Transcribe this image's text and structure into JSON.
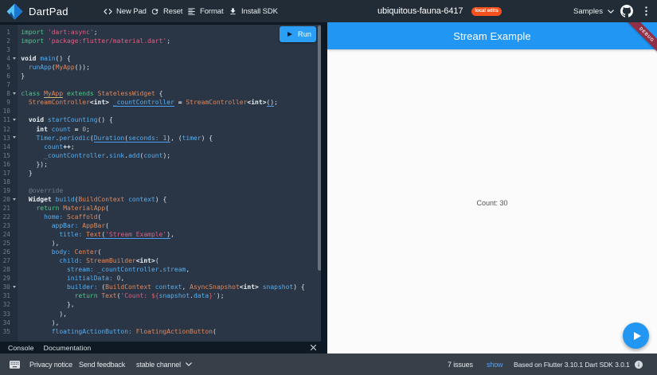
{
  "header": {
    "app_name": "DartPad",
    "buttons": {
      "new_pad": "New Pad",
      "reset": "Reset",
      "format": "Format",
      "install_sdk": "Install SDK"
    },
    "pad_title": "ubiquitous-fauna-6417",
    "badge": "local edits",
    "samples_label": "Samples",
    "icons": [
      "dart-logo",
      "code-icon",
      "refresh-icon",
      "format-align-icon",
      "download-icon",
      "chevron-down-icon",
      "github-icon",
      "kebab-menu-icon"
    ]
  },
  "editor": {
    "run_label": "Run",
    "fold_lines": [
      4,
      8,
      11,
      13,
      20,
      30
    ],
    "lines": [
      [
        [
          "kw",
          "import"
        ],
        [
          "pl",
          " "
        ],
        [
          "str",
          "'dart:async'"
        ],
        [
          "pl",
          ";"
        ]
      ],
      [
        [
          "kw",
          "import"
        ],
        [
          "pl",
          " "
        ],
        [
          "str",
          "'package:flutter/material.dart'"
        ],
        [
          "pl",
          ";"
        ]
      ],
      [],
      [
        [
          "ty",
          "void"
        ],
        [
          "pl",
          " "
        ],
        [
          "vr",
          "main"
        ],
        [
          "pl",
          "() {"
        ]
      ],
      [
        [
          "pl",
          "  "
        ],
        [
          "vr",
          "runApp"
        ],
        [
          "pl",
          "("
        ],
        [
          "cls",
          "MyApp"
        ],
        [
          "pl",
          "());"
        ]
      ],
      [
        [
          "pl",
          "}"
        ]
      ],
      [],
      [
        [
          "kw",
          "class"
        ],
        [
          "pl",
          " "
        ],
        [
          "cls uy",
          "MyApp"
        ],
        [
          "pl",
          " "
        ],
        [
          "kw",
          "extends"
        ],
        [
          "pl",
          " "
        ],
        [
          "cls",
          "StatelessWidget"
        ],
        [
          "pl",
          " {"
        ]
      ],
      [
        [
          "pl",
          "  "
        ],
        [
          "cls",
          "StreamController"
        ],
        [
          "op",
          "<int>"
        ],
        [
          "pl",
          " "
        ],
        [
          "vr ub",
          "_countController"
        ],
        [
          "pl",
          " "
        ],
        [
          "op",
          "="
        ],
        [
          "pl",
          " "
        ],
        [
          "cls",
          "StreamController"
        ],
        [
          "op",
          "<int>"
        ],
        [
          "pl ub",
          "()"
        ],
        [
          "pl",
          ";"
        ]
      ],
      [],
      [
        [
          "pl",
          "  "
        ],
        [
          "ty",
          "void"
        ],
        [
          "pl",
          " "
        ],
        [
          "vr",
          "startCounting"
        ],
        [
          "pl",
          "() {"
        ]
      ],
      [
        [
          "pl",
          "    "
        ],
        [
          "ty",
          "int"
        ],
        [
          "pl",
          " "
        ],
        [
          "vr",
          "count"
        ],
        [
          "pl",
          " "
        ],
        [
          "op",
          "="
        ],
        [
          "pl",
          " "
        ],
        [
          "nm",
          "0"
        ],
        [
          "pl",
          ";"
        ]
      ],
      [
        [
          "pl",
          "    "
        ],
        [
          "vr",
          "Timer"
        ],
        [
          "pl",
          "."
        ],
        [
          "vr",
          "periodic"
        ],
        [
          "pl",
          "("
        ],
        [
          "vr ub",
          "Duration"
        ],
        [
          "pl ub",
          "("
        ],
        [
          "vr ub",
          "seconds:"
        ],
        [
          "pl ub",
          " "
        ],
        [
          "nm ub",
          "1"
        ],
        [
          "pl ub",
          ")"
        ],
        [
          "pl",
          ", ("
        ],
        [
          "vr",
          "timer"
        ],
        [
          "pl",
          ") {"
        ]
      ],
      [
        [
          "pl",
          "      "
        ],
        [
          "vr",
          "count"
        ],
        [
          "op",
          "++"
        ],
        [
          "pl",
          ";"
        ]
      ],
      [
        [
          "pl",
          "      "
        ],
        [
          "vr",
          "_countController"
        ],
        [
          "pl",
          "."
        ],
        [
          "vr",
          "sink"
        ],
        [
          "pl",
          "."
        ],
        [
          "vr",
          "add"
        ],
        [
          "pl",
          "("
        ],
        [
          "vr",
          "count"
        ],
        [
          "pl",
          ");"
        ]
      ],
      [
        [
          "pl",
          "    });"
        ]
      ],
      [
        [
          "pl",
          "  }"
        ]
      ],
      [],
      [
        [
          "pl",
          "  "
        ],
        [
          "mt",
          "@override"
        ]
      ],
      [
        [
          "pl",
          "  "
        ],
        [
          "ty",
          "Widget"
        ],
        [
          "pl",
          " "
        ],
        [
          "vr",
          "build"
        ],
        [
          "pl",
          "("
        ],
        [
          "cls",
          "BuildContext"
        ],
        [
          "pl",
          " "
        ],
        [
          "vr",
          "context"
        ],
        [
          "pl",
          ") {"
        ]
      ],
      [
        [
          "pl",
          "    "
        ],
        [
          "kw",
          "return"
        ],
        [
          "pl",
          " "
        ],
        [
          "cls",
          "MaterialApp"
        ],
        [
          "pl",
          "("
        ]
      ],
      [
        [
          "pl",
          "      "
        ],
        [
          "vr",
          "home:"
        ],
        [
          "pl",
          " "
        ],
        [
          "cls",
          "Scaffold"
        ],
        [
          "pl",
          "("
        ]
      ],
      [
        [
          "pl",
          "        "
        ],
        [
          "vr",
          "appBar:"
        ],
        [
          "pl",
          " "
        ],
        [
          "cls",
          "AppBar"
        ],
        [
          "pl",
          "("
        ]
      ],
      [
        [
          "pl",
          "          "
        ],
        [
          "vr",
          "title:"
        ],
        [
          "pl",
          " "
        ],
        [
          "cls ub",
          "Text"
        ],
        [
          "pl ub",
          "("
        ],
        [
          "str ub",
          "'Stream Example'"
        ],
        [
          "pl ub",
          ")"
        ],
        [
          "pl",
          ","
        ]
      ],
      [
        [
          "pl",
          "        ),"
        ]
      ],
      [
        [
          "pl",
          "        "
        ],
        [
          "vr",
          "body:"
        ],
        [
          "pl",
          " "
        ],
        [
          "cls",
          "Center"
        ],
        [
          "pl",
          "("
        ]
      ],
      [
        [
          "pl",
          "          "
        ],
        [
          "vr",
          "child:"
        ],
        [
          "pl",
          " "
        ],
        [
          "cls",
          "StreamBuilder"
        ],
        [
          "op",
          "<int>"
        ],
        [
          "pl",
          "("
        ]
      ],
      [
        [
          "pl",
          "            "
        ],
        [
          "vr",
          "stream:"
        ],
        [
          "pl",
          " "
        ],
        [
          "vr",
          "_countController"
        ],
        [
          "pl",
          "."
        ],
        [
          "vr",
          "stream"
        ],
        [
          "pl",
          ","
        ]
      ],
      [
        [
          "pl",
          "            "
        ],
        [
          "vr",
          "initialData:"
        ],
        [
          "pl",
          " "
        ],
        [
          "nm",
          "0"
        ],
        [
          "pl",
          ","
        ]
      ],
      [
        [
          "pl",
          "            "
        ],
        [
          "vr",
          "builder:"
        ],
        [
          "pl",
          " ("
        ],
        [
          "cls",
          "BuildContext"
        ],
        [
          "pl",
          " "
        ],
        [
          "vr",
          "context"
        ],
        [
          "pl",
          ", "
        ],
        [
          "cls",
          "AsyncSnapshot"
        ],
        [
          "op",
          "<int>"
        ],
        [
          "pl",
          " "
        ],
        [
          "vr",
          "snapshot"
        ],
        [
          "pl",
          ") {"
        ]
      ],
      [
        [
          "pl",
          "              "
        ],
        [
          "kw",
          "return"
        ],
        [
          "pl",
          " "
        ],
        [
          "cls",
          "Text"
        ],
        [
          "pl",
          "("
        ],
        [
          "str",
          "'Count: "
        ],
        [
          "it",
          "${"
        ],
        [
          "vr",
          "snapshot"
        ],
        [
          "pl",
          "."
        ],
        [
          "vr",
          "data"
        ],
        [
          "it",
          "}"
        ],
        [
          "str",
          "'"
        ],
        [
          "pl",
          ");"
        ]
      ],
      [
        [
          "pl",
          "            },"
        ]
      ],
      [
        [
          "pl",
          "          ),"
        ]
      ],
      [
        [
          "pl",
          "        ),"
        ]
      ],
      [
        [
          "pl",
          "        "
        ],
        [
          "vr",
          "floatingActionButton:"
        ],
        [
          "pl",
          " "
        ],
        [
          "cls",
          "FloatingActionButton"
        ],
        [
          "pl",
          "("
        ]
      ]
    ]
  },
  "tabs": {
    "console": "Console",
    "documentation": "Documentation"
  },
  "preview": {
    "appbar_title": "Stream Example",
    "debug_banner": "DEBUG",
    "body_text": "Count: 30"
  },
  "footer": {
    "privacy": "Privacy notice",
    "feedback": "Send feedback",
    "channel": "stable channel",
    "issues": "7 issues",
    "show": "show",
    "based_on": "Based on Flutter 3.10.1 Dart SDK 3.0.1"
  },
  "colors": {
    "accent_blue": "#2196f3",
    "run_button_blue": "#2b9ef5",
    "badge_orange": "#f4511e",
    "debug_ribbon_red": "#902f45",
    "link_blue": "#5aa2f0",
    "editor_background": "#2a3645",
    "header_background": "#212c36",
    "footer_background": "#373f48"
  }
}
